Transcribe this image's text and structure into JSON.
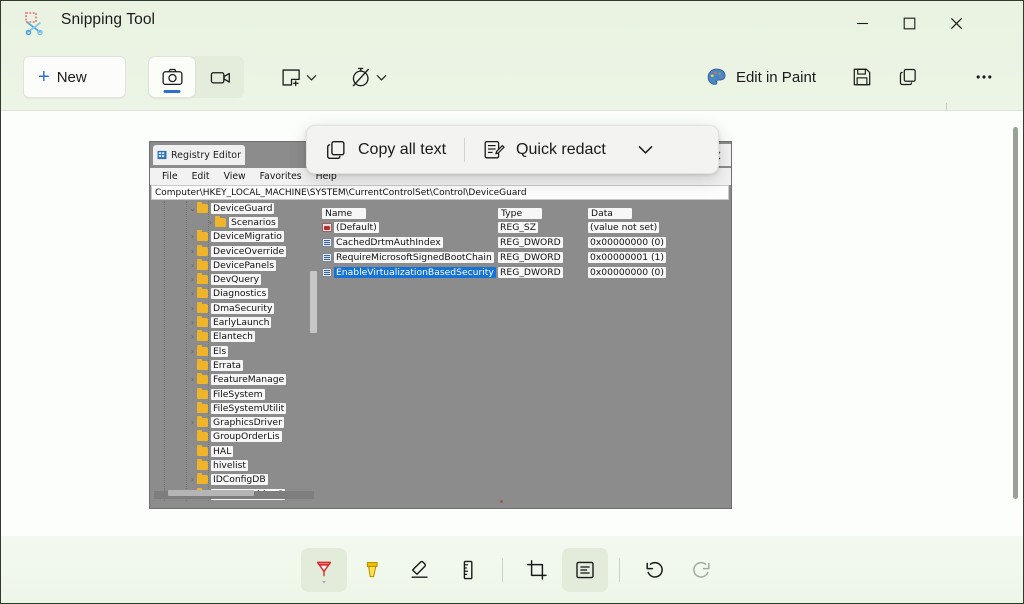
{
  "window": {
    "app_title": "Snipping Tool",
    "app_icon": "snipping-tool-icon",
    "controls": {
      "minimize": "minimize-icon",
      "maximize": "maximize-icon",
      "close": "close-icon"
    }
  },
  "toolbar": {
    "new_label": "New",
    "new_plus": "+",
    "mode_screenshot": "camera-icon",
    "mode_video": "video-camera-icon",
    "snip_mode_icon": "rectangle-snip-icon",
    "snip_mode_chevron": "chevron-down-icon",
    "delay_icon": "no-delay-timer-icon",
    "delay_chevron": "chevron-down-icon",
    "edit_in_paint_label": "Edit in Paint",
    "edit_in_paint_icon": "paint-palette-icon",
    "save_icon": "save-floppy-icon",
    "copy_icon": "copy-icon",
    "more_icon": "more-ellipsis-icon"
  },
  "ocr_popup": {
    "copy_all_text_label": "Copy all text",
    "copy_all_text_icon": "copy-icon",
    "quick_redact_label": "Quick redact",
    "quick_redact_icon": "redact-pencil-icon",
    "chevron_icon": "chevron-down-icon"
  },
  "bottom_tools": [
    {
      "name": "ballpoint-pen-tool",
      "icon": "pen-icon",
      "active": true,
      "chevron": "ˇ",
      "color": "#d92d2d"
    },
    {
      "name": "highlighter-tool",
      "icon": "highlighter-icon",
      "active": false,
      "chevron": "",
      "color": "#f2c300"
    },
    {
      "name": "eraser-tool",
      "icon": "eraser-icon",
      "active": false,
      "chevron": "",
      "color": "#1b1b1b"
    },
    {
      "name": "ruler-tool",
      "icon": "ruler-icon",
      "active": false,
      "chevron": "",
      "color": "#1b1b1b"
    },
    {
      "name": "crop-tool",
      "icon": "crop-icon",
      "active": false,
      "chevron": "",
      "color": "#1b1b1b"
    },
    {
      "name": "text-actions-tool",
      "icon": "text-actions-icon",
      "active": true,
      "chevron": "",
      "color": "#1b1b1b"
    },
    {
      "name": "undo-button",
      "icon": "undo-icon",
      "active": false,
      "chevron": "",
      "color": "#1b1b1b"
    },
    {
      "name": "redo-button",
      "icon": "redo-icon",
      "active": false,
      "chevron": "",
      "color": "#9aa296"
    }
  ],
  "captured_image": {
    "app_name": "Registry Editor",
    "tab_title": "Registry Editor",
    "menu": [
      "File",
      "Edit",
      "View",
      "Favorites",
      "Help"
    ],
    "address_path": "Computer\\HKEY_LOCAL_MACHINE\\SYSTEM\\CurrentControlSet\\Control\\DeviceGuard",
    "window_controls": {
      "minimize": "minimize-icon",
      "maximize": "maximize-icon",
      "close": "close-icon"
    },
    "tree_items": [
      {
        "label": "DeviceGuard",
        "indent": 2,
        "chevron": "⌄",
        "expanded": true
      },
      {
        "label": "Scenarios",
        "indent": 3,
        "chevron": "›",
        "expanded": false
      },
      {
        "label": "DeviceMigratio",
        "indent": 2,
        "chevron": "›",
        "expanded": false
      },
      {
        "label": "DeviceOverride",
        "indent": 2,
        "chevron": "›",
        "expanded": false
      },
      {
        "label": "DevicePanels",
        "indent": 2,
        "chevron": "›",
        "expanded": false
      },
      {
        "label": "DevQuery",
        "indent": 2,
        "chevron": "›",
        "expanded": false
      },
      {
        "label": "Diagnostics",
        "indent": 2,
        "chevron": "›",
        "expanded": false
      },
      {
        "label": "DmaSecurity",
        "indent": 2,
        "chevron": "›",
        "expanded": false
      },
      {
        "label": "EarlyLaunch",
        "indent": 2,
        "chevron": "›",
        "expanded": false
      },
      {
        "label": "Elantech",
        "indent": 2,
        "chevron": "›",
        "expanded": false
      },
      {
        "label": "Els",
        "indent": 2,
        "chevron": "›",
        "expanded": false
      },
      {
        "label": "Errata",
        "indent": 2,
        "chevron": "",
        "expanded": false
      },
      {
        "label": "FeatureManage",
        "indent": 2,
        "chevron": "›",
        "expanded": false
      },
      {
        "label": "FileSystem",
        "indent": 2,
        "chevron": "",
        "expanded": false
      },
      {
        "label": "FileSystemUtilit",
        "indent": 2,
        "chevron": "",
        "expanded": false
      },
      {
        "label": "GraphicsDriver",
        "indent": 2,
        "chevron": "›",
        "expanded": false
      },
      {
        "label": "GroupOrderLis",
        "indent": 2,
        "chevron": "",
        "expanded": false
      },
      {
        "label": "HAL",
        "indent": 2,
        "chevron": "",
        "expanded": false
      },
      {
        "label": "hivelist",
        "indent": 2,
        "chevron": "",
        "expanded": false
      },
      {
        "label": "IDConfigDB",
        "indent": 2,
        "chevron": "›",
        "expanded": false
      },
      {
        "label": "InitialMachineC",
        "indent": 2,
        "chevron": "",
        "expanded": false
      }
    ],
    "value_columns": [
      "Name",
      "Type",
      "Data"
    ],
    "values": [
      {
        "name": "(Default)",
        "type": "REG_SZ",
        "data": "(value not set)",
        "icon": "registry-string-icon",
        "selected": false
      },
      {
        "name": "CachedDrtmAuthIndex",
        "type": "REG_DWORD",
        "data": "0x00000000 (0)",
        "icon": "registry-dword-icon",
        "selected": false
      },
      {
        "name": "RequireMicrosoftSignedBootChain",
        "type": "REG_DWORD",
        "data": "0x00000001 (1)",
        "icon": "registry-dword-icon",
        "selected": false
      },
      {
        "name": "EnableVirtualizationBasedSecurity",
        "type": "REG_DWORD",
        "data": "0x00000000 (0)",
        "icon": "registry-dword-icon",
        "selected": true
      }
    ]
  },
  "colors": {
    "accent": "#2f6fd0",
    "window_bg": "#eef6e8",
    "canvas_bg": "#fbfefa",
    "selection_blue": "#1572d6",
    "capture_gray": "#8c8c8c"
  }
}
